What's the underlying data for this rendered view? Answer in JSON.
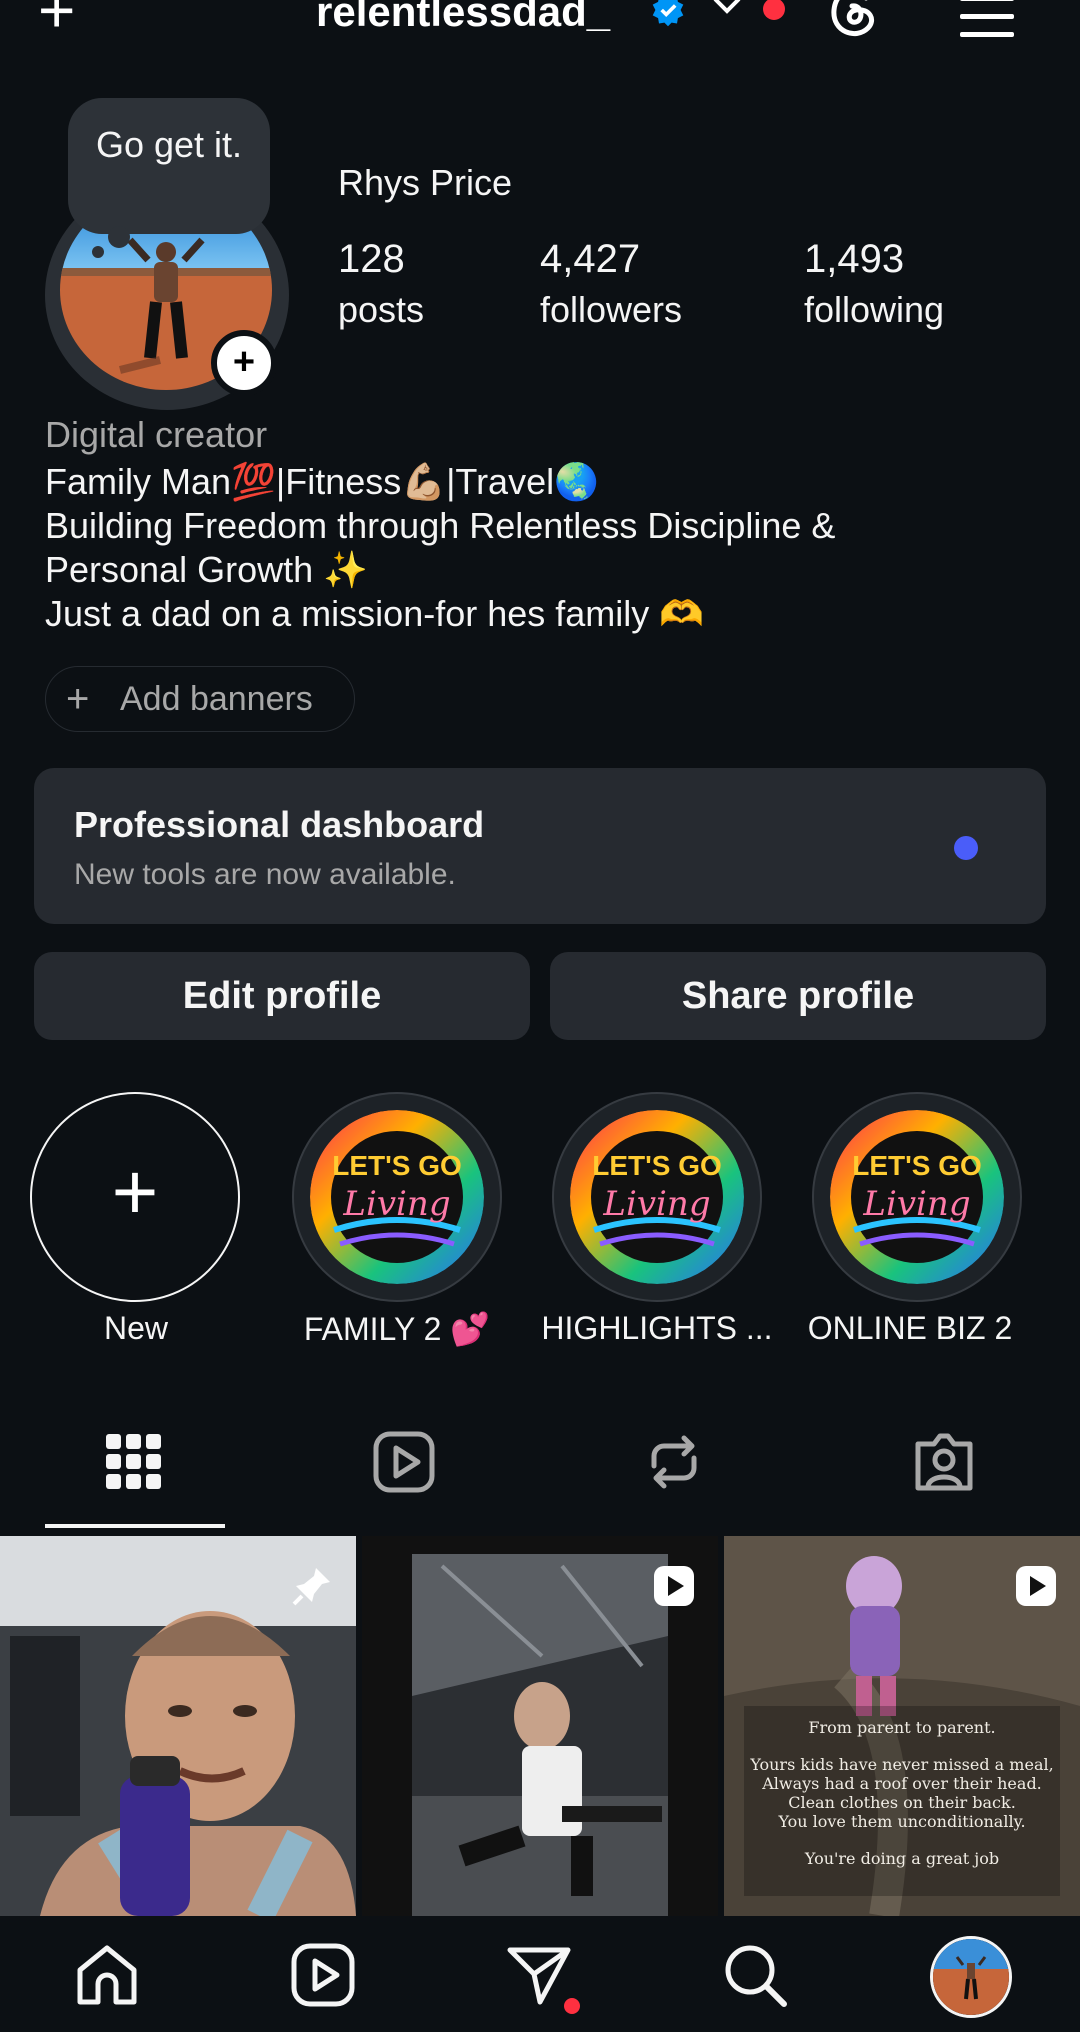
{
  "header": {
    "username": "relentlessdad_",
    "create_icon": "plus-icon",
    "verified_icon": "verified-badge-icon",
    "switch_icon": "chevron-down-icon",
    "threads_icon": "threads-icon",
    "menu_icon": "hamburger-menu-icon",
    "accent": "#0095f6",
    "notification_color": "#ff3040"
  },
  "profile": {
    "note": "Go get it.",
    "full_name": "Rhys Price",
    "stats": [
      {
        "value": "128",
        "label": "posts"
      },
      {
        "value": "4,427",
        "label": "followers"
      },
      {
        "value": "1,493",
        "label": "following"
      }
    ],
    "category": "Digital creator",
    "bio_lines": [
      "Family Man💯|Fitness💪🏼|Travel🌏",
      "Building Freedom through Relentless Discipline &",
      "Personal Growth ✨",
      "Just a dad on a mission-for hes family 🫶"
    ],
    "add_banners": "Add banners"
  },
  "dashboard": {
    "title": "Professional dashboard",
    "subtitle": "New tools are now available.",
    "dot_color": "#4a5df9"
  },
  "actions": {
    "edit": "Edit profile",
    "share": "Share profile"
  },
  "highlights": {
    "new_label": "New",
    "items": [
      {
        "label": "FAMILY 2 💕",
        "cover_text_1": "LET'S GO",
        "cover_text_2": "Living"
      },
      {
        "label": "HIGHLIGHTS ...",
        "cover_text_1": "LET'S GO",
        "cover_text_2": "Living"
      },
      {
        "label": "ONLINE BIZ 2",
        "cover_text_1": "LET'S GO",
        "cover_text_2": "Living"
      }
    ]
  },
  "tabs": [
    "grid-icon",
    "reels-icon",
    "reposts-icon",
    "tagged-icon"
  ],
  "posts": {
    "third_caption": [
      "From parent to parent.",
      "Yours kids have never missed a meal,",
      "Always had a roof over their head.",
      "Clean clothes on their back.",
      "You love them unconditionally.",
      "You're doing a great job"
    ]
  },
  "nav": [
    "home-icon",
    "reels-icon",
    "direct-messages-icon",
    "search-icon",
    "profile-avatar"
  ]
}
